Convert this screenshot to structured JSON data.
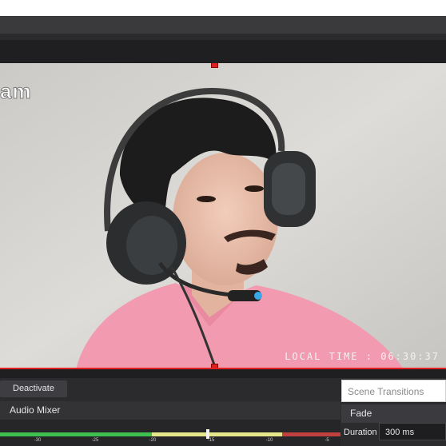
{
  "source": {
    "watermark": "am",
    "overlay_time": "LOCAL TIME : 06:30:37"
  },
  "controls": {
    "deactivate_label": "Deactivate"
  },
  "audio_mixer": {
    "title": "Audio Mixer",
    "scale_ticks": [
      "-30",
      "-25",
      "-20",
      "-15",
      "-10",
      "-5"
    ]
  },
  "transitions": {
    "title": "Scene Transitions",
    "selected": "Fade",
    "duration_label": "Duration",
    "duration_value": "300 ms"
  },
  "colors": {
    "selection": "#e02020",
    "meter_green": "#3fbf4f",
    "meter_yellow": "#e6e68a",
    "meter_red": "#c04040"
  }
}
